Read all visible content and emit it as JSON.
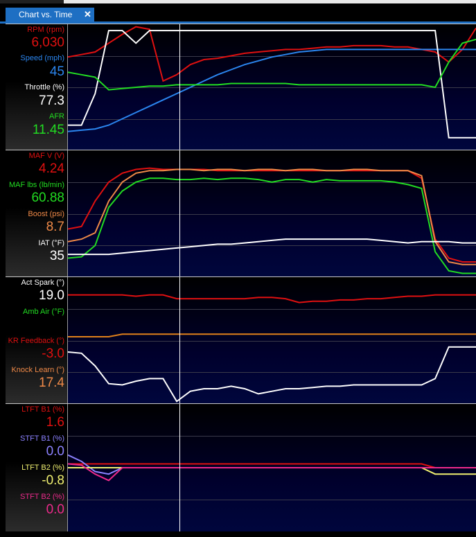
{
  "window": {
    "tab_title": "Chart vs. Time",
    "close_glyph": "✕"
  },
  "colors": {
    "red": "#e01010",
    "blue": "#2b86f0",
    "white": "#ffffff",
    "green": "#22dd22",
    "orange": "#f08a48",
    "purple": "#8c82ff",
    "yellow": "#f0f070",
    "magenta": "#ee2a8c",
    "gold": "#e0801a"
  },
  "panels": [
    {
      "channels": [
        {
          "label": "RPM (rpm)",
          "value": "6,030",
          "color": "#e01010"
        },
        {
          "label": "Speed (mph)",
          "value": "45",
          "color": "#2b86f0"
        },
        {
          "label": "Throttle (%)",
          "value": "77.3",
          "color": "#ffffff"
        },
        {
          "label": "AFR",
          "value": "11.45",
          "color": "#22dd22"
        }
      ]
    },
    {
      "channels": [
        {
          "label": "MAF V (V)",
          "value": "4.24",
          "color": "#e01010"
        },
        {
          "label": "MAF lbs (lb/min)",
          "value": "60.88",
          "color": "#22dd22"
        },
        {
          "label": "Boost (psi)",
          "value": "8.7",
          "color": "#f08a48"
        },
        {
          "label": "IAT (°F)",
          "value": "35",
          "color": "#ffffff"
        }
      ]
    },
    {
      "channels": [
        {
          "label": "Act Spark (°)",
          "value": "19.0",
          "color": "#ffffff"
        },
        {
          "label": "Amb Air (°F)",
          "value": "",
          "color": "#22dd22"
        },
        {
          "label": "KR Feedback (°)",
          "value": "-3.0",
          "color": "#e01010"
        },
        {
          "label": "Knock Learn (°)",
          "value": "17.4",
          "color": "#f08a48"
        }
      ]
    },
    {
      "channels": [
        {
          "label": "LTFT B1 (%)",
          "value": "1.6",
          "color": "#e01010"
        },
        {
          "label": "STFT B1 (%)",
          "value": "0.0",
          "color": "#8c82ff"
        },
        {
          "label": "LTFT B2 (%)",
          "value": "-0.8",
          "color": "#f0f070"
        },
        {
          "label": "STFT B2 (%)",
          "value": "0.0",
          "color": "#ee2a8c"
        }
      ]
    }
  ],
  "chart_data": [
    {
      "type": "line",
      "x": [
        0,
        1,
        2,
        3,
        4,
        5,
        6,
        7,
        8,
        9,
        10,
        11,
        12,
        13,
        14,
        15,
        16,
        17,
        18,
        19,
        20,
        21,
        22,
        23,
        24,
        25,
        26,
        27,
        28,
        29,
        30
      ],
      "series": [
        {
          "name": "RPM (rpm)",
          "color": "#e01010",
          "values": [
            0.74,
            0.76,
            0.78,
            0.85,
            0.92,
            0.98,
            0.96,
            0.55,
            0.6,
            0.68,
            0.72,
            0.73,
            0.75,
            0.77,
            0.78,
            0.79,
            0.8,
            0.8,
            0.81,
            0.82,
            0.82,
            0.83,
            0.83,
            0.83,
            0.82,
            0.82,
            0.8,
            0.78,
            0.7,
            0.8,
            0.97
          ]
        },
        {
          "name": "Speed (mph)",
          "color": "#2b86f0",
          "values": [
            0.15,
            0.16,
            0.17,
            0.2,
            0.25,
            0.3,
            0.35,
            0.4,
            0.45,
            0.5,
            0.55,
            0.6,
            0.64,
            0.68,
            0.71,
            0.74,
            0.76,
            0.78,
            0.79,
            0.8,
            0.8,
            0.8,
            0.8,
            0.8,
            0.8,
            0.8,
            0.8,
            0.8,
            0.8,
            0.8,
            0.8
          ]
        },
        {
          "name": "Throttle (%)",
          "color": "#ffffff",
          "values": [
            0.2,
            0.2,
            0.45,
            0.95,
            0.95,
            0.85,
            0.95,
            0.95,
            0.95,
            0.95,
            0.95,
            0.95,
            0.95,
            0.95,
            0.95,
            0.95,
            0.95,
            0.95,
            0.95,
            0.95,
            0.95,
            0.95,
            0.95,
            0.95,
            0.95,
            0.95,
            0.95,
            0.95,
            0.1,
            0.1,
            0.1
          ]
        },
        {
          "name": "AFR",
          "color": "#22dd22",
          "values": [
            0.62,
            0.6,
            0.58,
            0.48,
            0.49,
            0.5,
            0.51,
            0.51,
            0.52,
            0.52,
            0.52,
            0.52,
            0.53,
            0.53,
            0.53,
            0.53,
            0.53,
            0.52,
            0.52,
            0.52,
            0.52,
            0.52,
            0.52,
            0.52,
            0.52,
            0.52,
            0.52,
            0.5,
            0.7,
            0.85,
            0.88
          ]
        }
      ]
    },
    {
      "type": "line",
      "x": [
        0,
        1,
        2,
        3,
        4,
        5,
        6,
        7,
        8,
        9,
        10,
        11,
        12,
        13,
        14,
        15,
        16,
        17,
        18,
        19,
        20,
        21,
        22,
        23,
        24,
        25,
        26,
        27,
        28,
        29,
        30
      ],
      "series": [
        {
          "name": "MAF V (V)",
          "color": "#e01010",
          "values": [
            0.38,
            0.4,
            0.6,
            0.75,
            0.82,
            0.85,
            0.86,
            0.85,
            0.85,
            0.85,
            0.85,
            0.84,
            0.84,
            0.84,
            0.84,
            0.84,
            0.84,
            0.84,
            0.84,
            0.84,
            0.84,
            0.84,
            0.84,
            0.84,
            0.84,
            0.84,
            0.78,
            0.3,
            0.15,
            0.12,
            0.12
          ]
        },
        {
          "name": "MAF lbs (lb/min)",
          "color": "#22dd22",
          "values": [
            0.15,
            0.16,
            0.25,
            0.55,
            0.68,
            0.75,
            0.78,
            0.78,
            0.77,
            0.77,
            0.78,
            0.77,
            0.78,
            0.78,
            0.77,
            0.75,
            0.77,
            0.77,
            0.75,
            0.77,
            0.76,
            0.76,
            0.76,
            0.76,
            0.75,
            0.73,
            0.7,
            0.2,
            0.05,
            0.03,
            0.03
          ]
        },
        {
          "name": "Boost (psi)",
          "color": "#f08a48",
          "values": [
            0.28,
            0.3,
            0.35,
            0.6,
            0.75,
            0.82,
            0.84,
            0.84,
            0.85,
            0.85,
            0.84,
            0.85,
            0.85,
            0.84,
            0.85,
            0.85,
            0.84,
            0.85,
            0.85,
            0.84,
            0.84,
            0.85,
            0.85,
            0.84,
            0.84,
            0.84,
            0.8,
            0.28,
            0.12,
            0.1,
            0.1
          ]
        },
        {
          "name": "IAT (°F)",
          "color": "#ffffff",
          "values": [
            0.18,
            0.18,
            0.18,
            0.18,
            0.19,
            0.2,
            0.21,
            0.22,
            0.23,
            0.24,
            0.25,
            0.26,
            0.26,
            0.27,
            0.28,
            0.29,
            0.3,
            0.3,
            0.3,
            0.3,
            0.3,
            0.3,
            0.3,
            0.29,
            0.28,
            0.27,
            0.28,
            0.28,
            0.28,
            0.27,
            0.27
          ]
        }
      ]
    },
    {
      "type": "line",
      "x": [
        0,
        1,
        2,
        3,
        4,
        5,
        6,
        7,
        8,
        9,
        10,
        11,
        12,
        13,
        14,
        15,
        16,
        17,
        18,
        19,
        20,
        21,
        22,
        23,
        24,
        25,
        26,
        27,
        28,
        29,
        30
      ],
      "series": [
        {
          "name": "Act Spark (°)",
          "color": "#ffffff",
          "values": [
            0.41,
            0.4,
            0.3,
            0.16,
            0.15,
            0.18,
            0.2,
            0.2,
            0.02,
            0.1,
            0.12,
            0.12,
            0.14,
            0.12,
            0.08,
            0.1,
            0.12,
            0.12,
            0.13,
            0.14,
            0.14,
            0.15,
            0.15,
            0.15,
            0.15,
            0.15,
            0.15,
            0.2,
            0.45,
            0.45,
            0.45
          ]
        },
        {
          "name": "Act Spark",
          "color": "#e01010",
          "values": [
            0.86,
            0.86,
            0.86,
            0.86,
            0.86,
            0.85,
            0.86,
            0.86,
            0.83,
            0.83,
            0.83,
            0.83,
            0.83,
            0.83,
            0.84,
            0.84,
            0.83,
            0.8,
            0.81,
            0.81,
            0.82,
            0.82,
            0.83,
            0.83,
            0.84,
            0.85,
            0.85,
            0.86,
            0.86,
            0.86,
            0.86
          ]
        },
        {
          "name": "Amb Air (°F)",
          "color": "#e0801a",
          "values": [
            0.53,
            0.53,
            0.53,
            0.53,
            0.55,
            0.55,
            0.55,
            0.55,
            0.55,
            0.55,
            0.55,
            0.55,
            0.55,
            0.55,
            0.55,
            0.55,
            0.55,
            0.55,
            0.55,
            0.55,
            0.55,
            0.55,
            0.55,
            0.55,
            0.55,
            0.55,
            0.55,
            0.55,
            0.55,
            0.55,
            0.55
          ]
        }
      ]
    },
    {
      "type": "line",
      "x": [
        0,
        1,
        2,
        3,
        4,
        5,
        6,
        7,
        8,
        9,
        10,
        11,
        12,
        13,
        14,
        15,
        16,
        17,
        18,
        19,
        20,
        21,
        22,
        23,
        24,
        25,
        26,
        27,
        28,
        29,
        30
      ],
      "series": [
        {
          "name": "LTFT B1 (%)",
          "color": "#e01010",
          "values": [
            0.53,
            0.53,
            0.53,
            0.53,
            0.53,
            0.53,
            0.53,
            0.53,
            0.53,
            0.53,
            0.53,
            0.53,
            0.53,
            0.53,
            0.53,
            0.53,
            0.53,
            0.53,
            0.53,
            0.53,
            0.53,
            0.53,
            0.53,
            0.53,
            0.53,
            0.53,
            0.53,
            0.5,
            0.5,
            0.5,
            0.5
          ]
        },
        {
          "name": "STFT B1 (%)",
          "color": "#8c82ff",
          "values": [
            0.6,
            0.55,
            0.47,
            0.45,
            0.5,
            0.5,
            0.5,
            0.5,
            0.5,
            0.5,
            0.5,
            0.5,
            0.5,
            0.5,
            0.5,
            0.5,
            0.5,
            0.5,
            0.5,
            0.5,
            0.5,
            0.5,
            0.5,
            0.5,
            0.5,
            0.5,
            0.5,
            0.5,
            0.5,
            0.5,
            0.5
          ]
        },
        {
          "name": "LTFT B2 (%)",
          "color": "#f0f070",
          "values": [
            0.5,
            0.5,
            0.5,
            0.5,
            0.5,
            0.5,
            0.5,
            0.5,
            0.5,
            0.5,
            0.5,
            0.5,
            0.5,
            0.5,
            0.5,
            0.5,
            0.5,
            0.5,
            0.5,
            0.5,
            0.5,
            0.5,
            0.5,
            0.5,
            0.5,
            0.5,
            0.5,
            0.45,
            0.45,
            0.45,
            0.45
          ]
        },
        {
          "name": "STFT B2 (%)",
          "color": "#ee2a8c",
          "values": [
            0.53,
            0.52,
            0.45,
            0.4,
            0.5,
            0.5,
            0.5,
            0.5,
            0.5,
            0.5,
            0.5,
            0.5,
            0.5,
            0.5,
            0.5,
            0.5,
            0.5,
            0.5,
            0.5,
            0.5,
            0.5,
            0.5,
            0.5,
            0.5,
            0.5,
            0.5,
            0.5,
            0.5,
            0.5,
            0.5,
            0.5
          ]
        }
      ]
    }
  ]
}
